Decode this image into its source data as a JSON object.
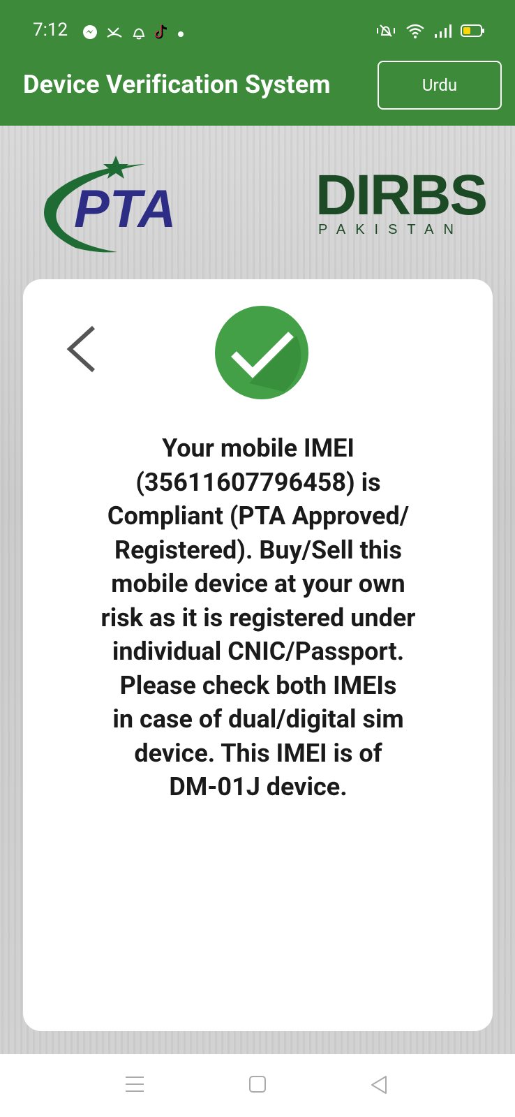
{
  "status_bar": {
    "time": "7:12",
    "left_icons": [
      "messenger-icon",
      "missed-call-icon",
      "alarm-icon",
      "tiktok-icon",
      "dot-icon"
    ],
    "right_icons": [
      "mute-vibrate-icon",
      "wifi-icon",
      "signal-icon",
      "battery-icon"
    ]
  },
  "header": {
    "title": "Device Verification System",
    "language_button": "Urdu",
    "color": "#3c8a3a"
  },
  "logos": {
    "left": {
      "text": "PTA",
      "color": "#2d2d86",
      "swoosh_color": "#1f6b34"
    },
    "right": {
      "text": "DIRBS",
      "subtitle": "PAKISTAN",
      "color": "#1c4a24"
    }
  },
  "result": {
    "status_icon": "check-circle-icon",
    "status_color": "#43a047",
    "message_lines": [
      "Your mobile IMEI",
      "(35611607796458) is",
      "Compliant (PTA Approved/",
      "Registered). Buy/Sell this",
      "mobile device at your own",
      "risk as it is registered under",
      "individual CNIC/Passport.",
      "Please check both IMEIs",
      "in case of dual/digital sim",
      "device. This IMEI is of",
      "DM-01J device."
    ]
  },
  "nav_bar": {
    "items": [
      "menu-icon",
      "home-icon",
      "back-icon"
    ]
  }
}
